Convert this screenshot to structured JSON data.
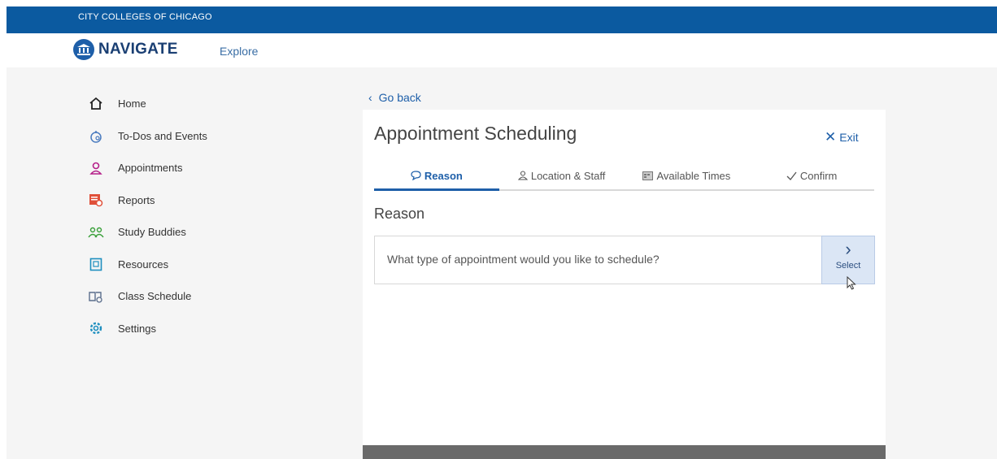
{
  "topbar": {
    "institution": "CITY COLLEGES OF CHICAGO"
  },
  "navbar": {
    "brand": "NAVIGATE",
    "explore_label": "Explore"
  },
  "sidebar": {
    "items": [
      {
        "label": "Home",
        "icon": "home-icon"
      },
      {
        "label": "To-Dos and Events",
        "icon": "todos-icon"
      },
      {
        "label": "Appointments",
        "icon": "person-icon"
      },
      {
        "label": "Reports",
        "icon": "reports-icon"
      },
      {
        "label": "Study Buddies",
        "icon": "study-buddies-icon"
      },
      {
        "label": "Resources",
        "icon": "resources-icon"
      },
      {
        "label": "Class Schedule",
        "icon": "class-schedule-icon"
      },
      {
        "label": "Settings",
        "icon": "gear-icon"
      }
    ]
  },
  "main": {
    "go_back": "Go back",
    "title": "Appointment Scheduling",
    "exit_label": "Exit",
    "tabs": [
      {
        "label": "Reason",
        "icon": "speech-bubble-icon",
        "active": true
      },
      {
        "label": "Location & Staff",
        "icon": "person-icon",
        "active": false
      },
      {
        "label": "Available Times",
        "icon": "calendar-icon",
        "active": false
      },
      {
        "label": "Confirm",
        "icon": "check-icon",
        "active": false
      }
    ],
    "section_heading": "Reason",
    "question": "What type of appointment would you like to schedule?",
    "select_label": "Select"
  },
  "colors": {
    "brand_blue": "#0b5aa0",
    "link_blue": "#1e5fa9",
    "select_bg": "#dbe6f5",
    "page_bg": "#f5f5f5"
  }
}
